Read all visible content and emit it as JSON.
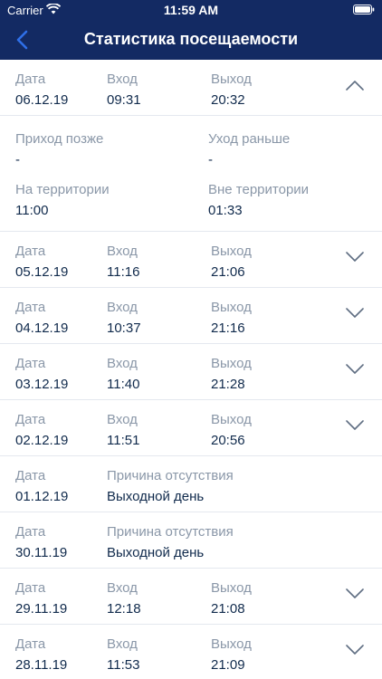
{
  "status_bar": {
    "carrier": "Carrier",
    "time": "11:59 AM"
  },
  "nav": {
    "title": "Статистика посещаемости"
  },
  "labels": {
    "date": "Дата",
    "in": "Вход",
    "out": "Выход",
    "late": "Приход позже",
    "early": "Уход раньше",
    "on_territory": "На территории",
    "off_territory": "Вне территории",
    "absence_reason": "Причина отсутствия"
  },
  "rows": [
    {
      "date": "06.12.19",
      "in": "09:31",
      "out": "20:32"
    },
    {
      "date": "05.12.19",
      "in": "11:16",
      "out": "21:06"
    },
    {
      "date": "04.12.19",
      "in": "10:37",
      "out": "21:16"
    },
    {
      "date": "03.12.19",
      "in": "11:40",
      "out": "21:28"
    },
    {
      "date": "02.12.19",
      "in": "11:51",
      "out": "20:56"
    },
    {
      "date": "01.12.19",
      "reason": "Выходной день"
    },
    {
      "date": "30.11.19",
      "reason": "Выходной день"
    },
    {
      "date": "29.11.19",
      "in": "12:18",
      "out": "21:08"
    },
    {
      "date": "28.11.19",
      "in": "11:53",
      "out": "21:09"
    }
  ],
  "expanded": {
    "late": "-",
    "early": "-",
    "on_territory": "11:00",
    "off_territory": "01:33"
  },
  "colors": {
    "header": "#132a63",
    "label": "#8a97a8",
    "value": "#102a4c",
    "accent": "#2f6fe8"
  }
}
